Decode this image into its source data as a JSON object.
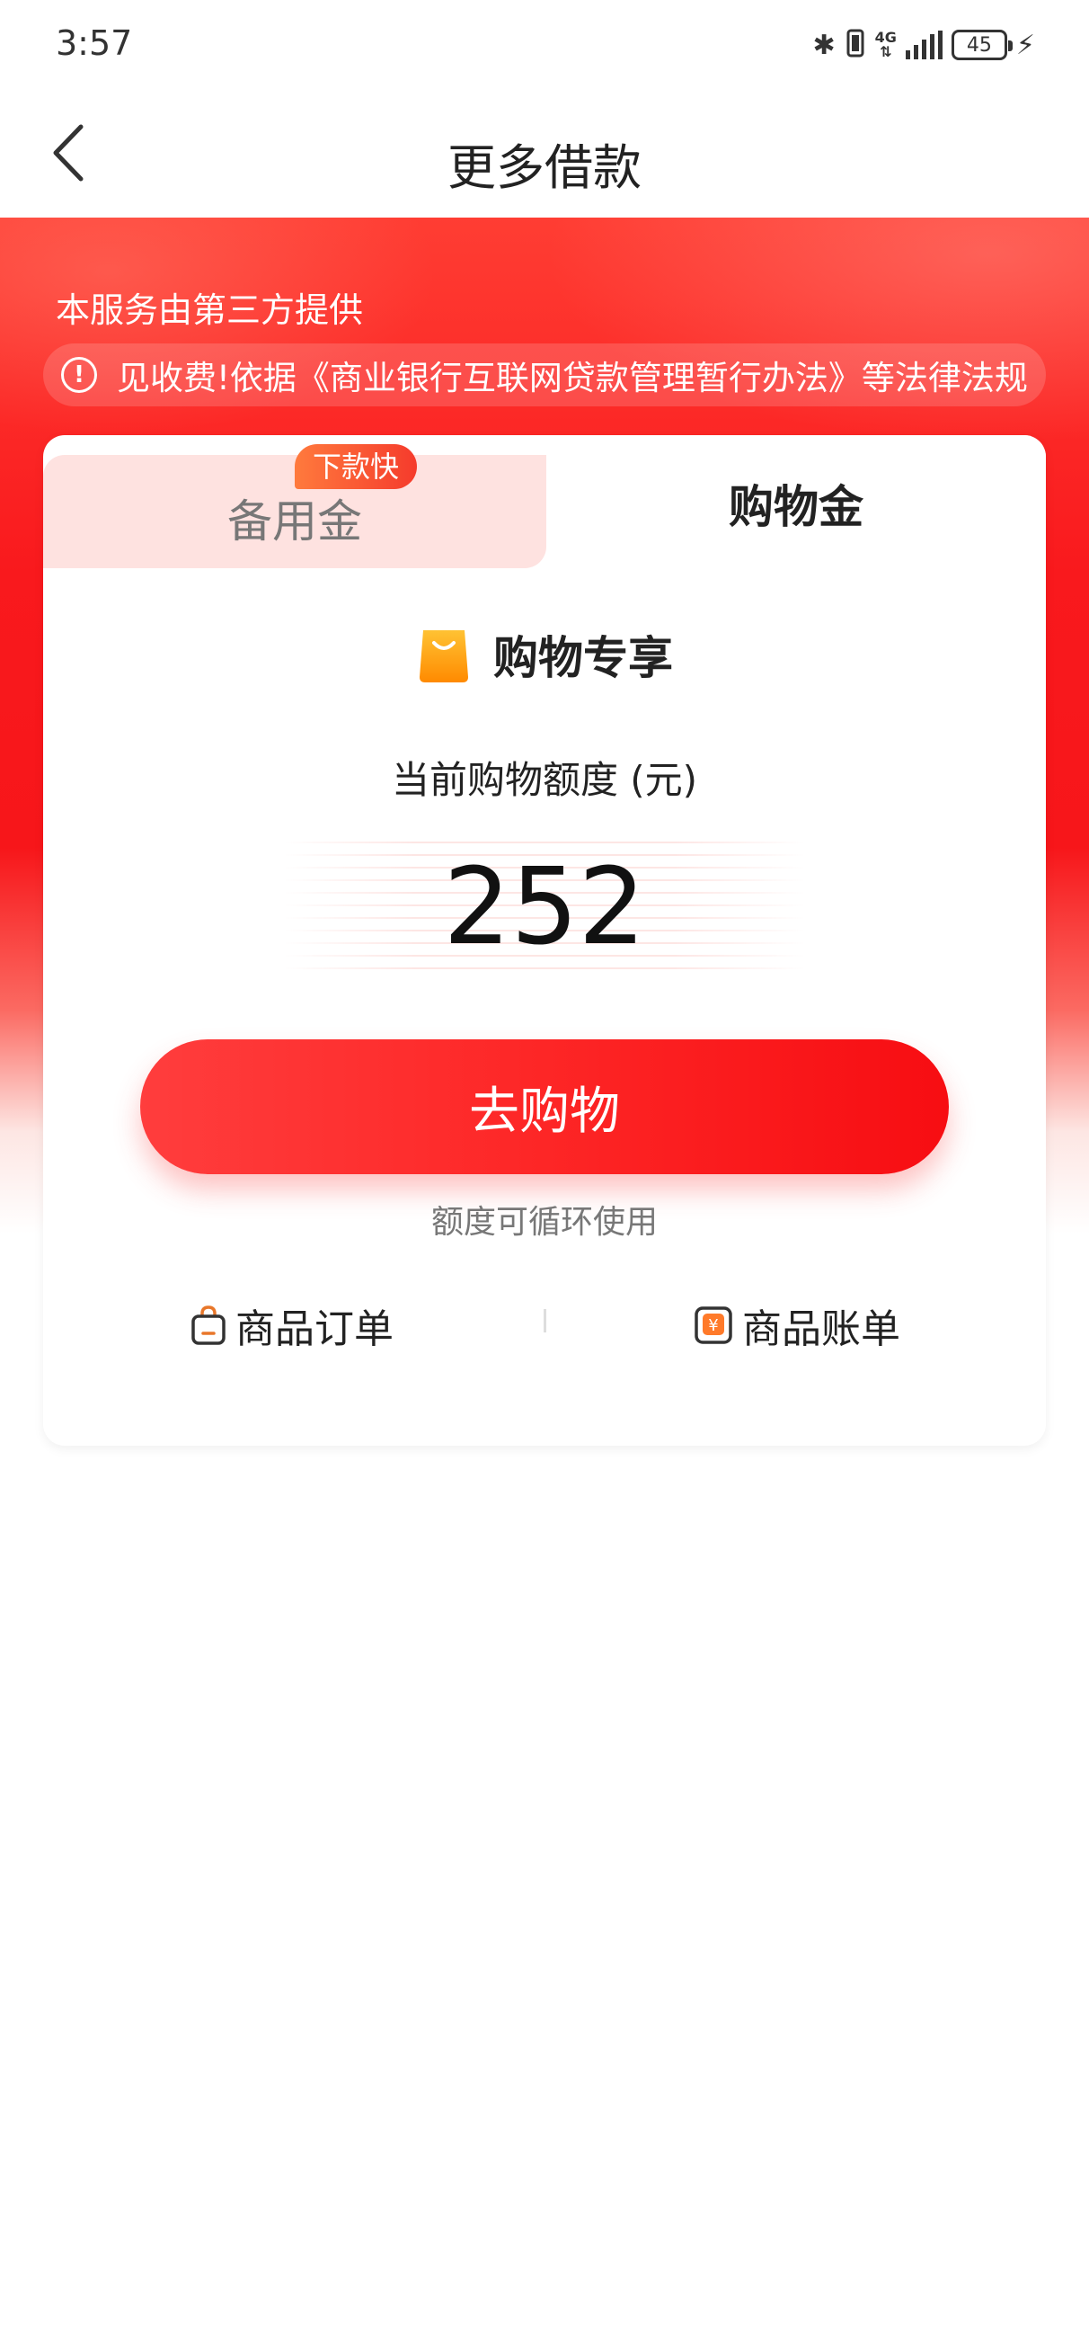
{
  "status_bar": {
    "time": "3:57",
    "bluetooth_glyph": "✱",
    "network_top": "4G",
    "network_bottom": "⇅",
    "battery": "45",
    "charging_glyph": "⚡",
    "icons": [
      "bluetooth-icon",
      "vibrate-icon",
      "network-4g-icon",
      "signal-icon",
      "battery-icon",
      "charging-icon"
    ]
  },
  "nav": {
    "title": "更多借款",
    "back_icon": "chevron-left-icon"
  },
  "hero": {
    "provider_text": "本服务由第三方提供",
    "notice_icon": "!",
    "notice_text": "见收费!依据《商业银行互联网贷款管理暂行办法》等法律法规"
  },
  "tabs": {
    "left_label": "备用金",
    "left_badge": "下款快",
    "right_label": "购物金",
    "active": "购物金"
  },
  "feature": {
    "icon": "shopping-bag-icon",
    "title": "购物专享"
  },
  "limit": {
    "label": "当前购物额度 (元)",
    "amount": "252"
  },
  "cta": {
    "label": "去购物",
    "note": "额度可循环使用"
  },
  "links": {
    "orders_label": "商品订单",
    "orders_icon": "order-bag-icon",
    "bills_label": "商品账单",
    "bills_icon": "yen-bill-icon",
    "yen_glyph": "¥"
  },
  "colors": {
    "brand_red": "#f7161a",
    "tab_inactive_bg": "#fee2e0",
    "badge_orange": "#ff7a3d",
    "bag_orange": "#ffa31a"
  }
}
